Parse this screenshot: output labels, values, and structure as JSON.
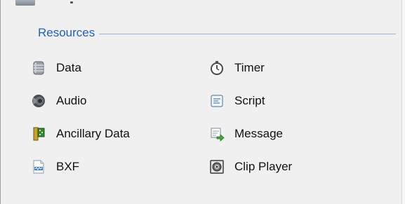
{
  "resources": {
    "title": "Resources",
    "left_column": [
      {
        "label": "Data",
        "icon": "database-icon"
      },
      {
        "label": "Audio",
        "icon": "speaker-icon"
      },
      {
        "label": "Ancillary Data",
        "icon": "ancillary-card-icon"
      },
      {
        "label": "BXF",
        "icon": "bxf-document-icon"
      }
    ],
    "right_column": [
      {
        "label": "Timer",
        "icon": "stopwatch-icon"
      },
      {
        "label": "Script",
        "icon": "script-icon"
      },
      {
        "label": "Message",
        "icon": "message-icon"
      },
      {
        "label": "Clip Player",
        "icon": "clip-player-icon"
      }
    ]
  },
  "colors": {
    "group_title": "#1f5fbf",
    "group_line": "#9ab4dd",
    "background": "#f0f0f0"
  }
}
